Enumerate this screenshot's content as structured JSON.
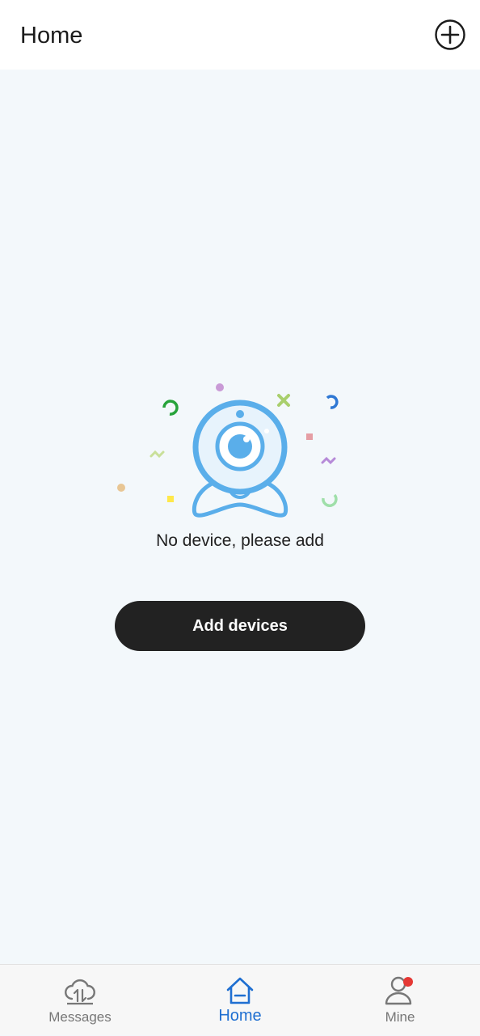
{
  "header": {
    "title": "Home",
    "add_icon": "plus-circle-icon"
  },
  "empty_state": {
    "illustration": "webcam-illustration",
    "message": "No device, please add",
    "button_label": "Add devices"
  },
  "bottom_nav": {
    "items": [
      {
        "label": "Messages",
        "icon": "cloud-sync-icon",
        "active": false
      },
      {
        "label": "Home",
        "icon": "home-icon",
        "active": true
      },
      {
        "label": "Mine",
        "icon": "person-icon",
        "active": false,
        "badge": true
      }
    ]
  },
  "colors": {
    "accent": "#1f6fd1",
    "illustration_blue": "#5aaeea",
    "button_bg": "#222222",
    "badge": "#e53935",
    "background": "#f3f8fb"
  }
}
